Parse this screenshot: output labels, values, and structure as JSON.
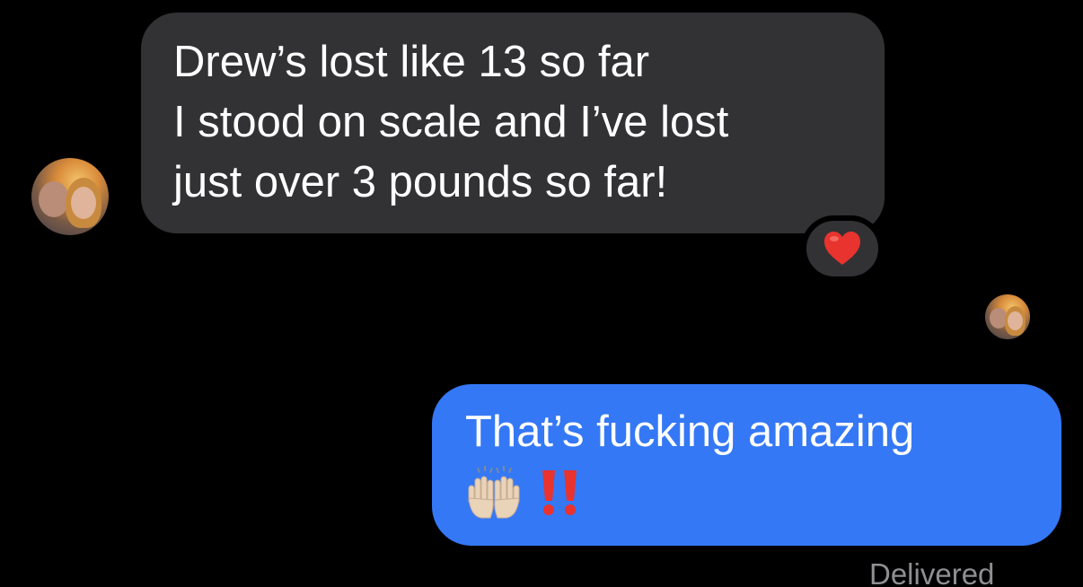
{
  "messages": {
    "incoming": {
      "lines": [
        "Drew’s lost like 13 so far",
        "I stood on scale and I’ve lost",
        "just over 3 pounds so far!"
      ],
      "reaction": "heart-reaction"
    },
    "outgoing": {
      "text": "That’s fucking amazing",
      "emoji": [
        "raising-hands-emoji",
        "double-exclamation-emoji"
      ]
    },
    "status": "Delivered"
  },
  "colors": {
    "incoming_bubble": "#323234",
    "outgoing_bubble": "#3478f6",
    "status_text": "#8e8e93",
    "heart": "#e8332f"
  }
}
